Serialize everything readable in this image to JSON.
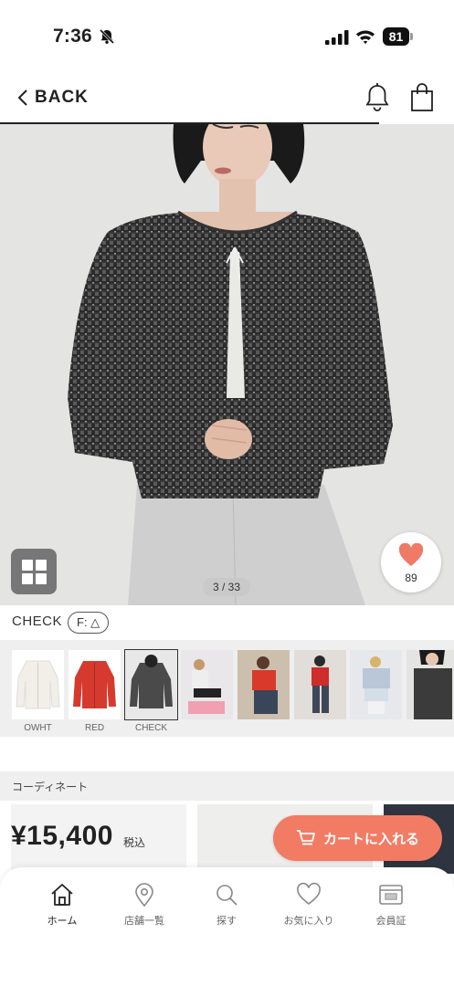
{
  "status_bar": {
    "time": "7:36",
    "battery": "81"
  },
  "nav": {
    "back_label": "BACK"
  },
  "hero": {
    "page_counter": "3 / 33",
    "favorite_count": "89"
  },
  "product": {
    "color_name": "CHECK",
    "fit_badge": "F: △"
  },
  "thumbnails": [
    {
      "label": "OWHT"
    },
    {
      "label": "RED"
    },
    {
      "label": "CHECK"
    },
    {
      "label": ""
    },
    {
      "label": ""
    },
    {
      "label": ""
    },
    {
      "label": ""
    },
    {
      "label": ""
    }
  ],
  "coordinate": {
    "title": "コーディネート"
  },
  "price": {
    "amount": "¥15,400",
    "tax_label": "税込"
  },
  "cart": {
    "label": "カートに入れる"
  },
  "tabs": [
    {
      "label": "ホーム",
      "icon": "home-icon"
    },
    {
      "label": "店舗一覧",
      "icon": "map-pin-icon"
    },
    {
      "label": "探す",
      "icon": "search-icon"
    },
    {
      "label": "お気に入り",
      "icon": "heart-icon"
    },
    {
      "label": "会員証",
      "icon": "member-card-icon"
    }
  ],
  "colors": {
    "accent": "#f27b64",
    "heart": "#ef7a66"
  }
}
